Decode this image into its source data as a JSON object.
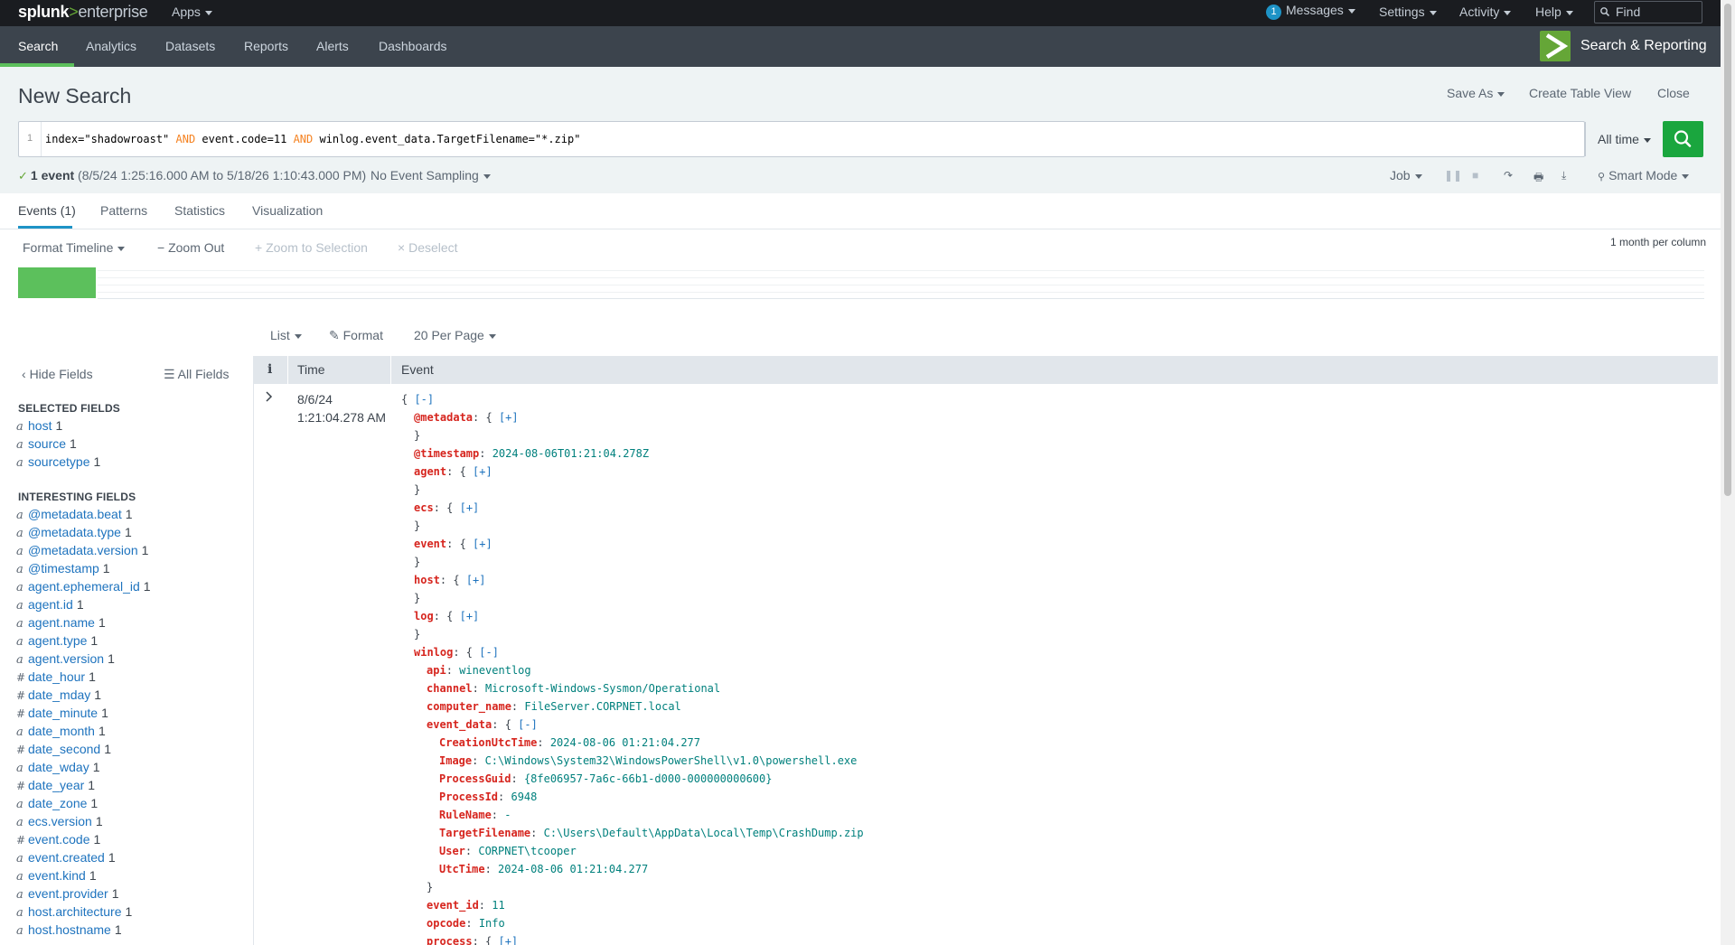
{
  "topbar": {
    "logo_brand": "splunk",
    "logo_sep": ">",
    "logo_product": "enterprise",
    "apps": "Apps",
    "messages_count": "1",
    "messages": "Messages",
    "settings": "Settings",
    "activity": "Activity",
    "help": "Help",
    "find_placeholder": "Find"
  },
  "appnav": {
    "items": [
      "Search",
      "Analytics",
      "Datasets",
      "Reports",
      "Alerts",
      "Dashboards"
    ],
    "active": "Search",
    "app_title": "Search & Reporting",
    "accent": "#65a637"
  },
  "header": {
    "title": "New Search",
    "save_as": "Save As",
    "create_table_view": "Create Table View",
    "close": "Close"
  },
  "search": {
    "line_number": "1",
    "query_parts": [
      {
        "t": "index=\"shadowroast\" ",
        "kw": false
      },
      {
        "t": "AND",
        "kw": true
      },
      {
        "t": " event.code=11 ",
        "kw": false
      },
      {
        "t": "AND",
        "kw": true
      },
      {
        "t": " winlog.event_data.TargetFilename=\"*.zip\"",
        "kw": false
      }
    ],
    "time_range": "All time",
    "button_color": "#1aa63e"
  },
  "job": {
    "count": "1 event",
    "range": "(8/5/24 1:25:16.000 AM to 5/18/26 1:10:43.000 PM)",
    "sampling": "No Event Sampling",
    "job_label": "Job",
    "mode": "Smart Mode"
  },
  "tabs": [
    "Events (1)",
    "Patterns",
    "Statistics",
    "Visualization"
  ],
  "timeline": {
    "format": "Format Timeline",
    "zoom_out": "Zoom Out",
    "zoom_selection": "Zoom to Selection",
    "deselect": "Deselect",
    "per_column": "1 month per column",
    "bar_color": "#5cc05c"
  },
  "results_controls": {
    "list": "List",
    "format": "Format",
    "per_page": "20 Per Page"
  },
  "sidebar": {
    "hide_fields": "Hide Fields",
    "all_fields": "All Fields",
    "selected_title": "SELECTED FIELDS",
    "selected": [
      {
        "type": "a",
        "name": "host",
        "count": "1"
      },
      {
        "type": "a",
        "name": "source",
        "count": "1"
      },
      {
        "type": "a",
        "name": "sourcetype",
        "count": "1"
      }
    ],
    "interesting_title": "INTERESTING FIELDS",
    "interesting": [
      {
        "type": "a",
        "name": "@metadata.beat",
        "count": "1"
      },
      {
        "type": "a",
        "name": "@metadata.type",
        "count": "1"
      },
      {
        "type": "a",
        "name": "@metadata.version",
        "count": "1"
      },
      {
        "type": "a",
        "name": "@timestamp",
        "count": "1"
      },
      {
        "type": "a",
        "name": "agent.ephemeral_id",
        "count": "1"
      },
      {
        "type": "a",
        "name": "agent.id",
        "count": "1"
      },
      {
        "type": "a",
        "name": "agent.name",
        "count": "1"
      },
      {
        "type": "a",
        "name": "agent.type",
        "count": "1"
      },
      {
        "type": "a",
        "name": "agent.version",
        "count": "1"
      },
      {
        "type": "#",
        "name": "date_hour",
        "count": "1"
      },
      {
        "type": "#",
        "name": "date_mday",
        "count": "1"
      },
      {
        "type": "#",
        "name": "date_minute",
        "count": "1"
      },
      {
        "type": "a",
        "name": "date_month",
        "count": "1"
      },
      {
        "type": "#",
        "name": "date_second",
        "count": "1"
      },
      {
        "type": "a",
        "name": "date_wday",
        "count": "1"
      },
      {
        "type": "#",
        "name": "date_year",
        "count": "1"
      },
      {
        "type": "a",
        "name": "date_zone",
        "count": "1"
      },
      {
        "type": "a",
        "name": "ecs.version",
        "count": "1"
      },
      {
        "type": "#",
        "name": "event.code",
        "count": "1"
      },
      {
        "type": "a",
        "name": "event.created",
        "count": "1"
      },
      {
        "type": "a",
        "name": "event.kind",
        "count": "1"
      },
      {
        "type": "a",
        "name": "event.provider",
        "count": "1"
      },
      {
        "type": "a",
        "name": "host.architecture",
        "count": "1"
      },
      {
        "type": "a",
        "name": "host.hostname",
        "count": "1"
      }
    ]
  },
  "results": {
    "col_info": "i",
    "col_time": "Time",
    "col_event": "Event",
    "event_date": "8/6/24",
    "event_time": "1:21:04.278 AM",
    "event_lines": [
      {
        "indent": 0,
        "parts": [
          {
            "c": "jb",
            "t": "{ "
          },
          {
            "c": "jl",
            "t": "[-]"
          }
        ]
      },
      {
        "indent": 1,
        "parts": [
          {
            "c": "jk",
            "t": "@metadata"
          },
          {
            "c": "jb",
            "t": ": { "
          },
          {
            "c": "jl",
            "t": "[+]"
          }
        ]
      },
      {
        "indent": 1,
        "parts": [
          {
            "c": "jb",
            "t": "}"
          }
        ]
      },
      {
        "indent": 1,
        "parts": [
          {
            "c": "jk",
            "t": "@timestamp"
          },
          {
            "c": "jb",
            "t": ": "
          },
          {
            "c": "jv",
            "t": "2024-08-06T01:21:04.278Z"
          }
        ]
      },
      {
        "indent": 1,
        "parts": [
          {
            "c": "jk",
            "t": "agent"
          },
          {
            "c": "jb",
            "t": ": { "
          },
          {
            "c": "jl",
            "t": "[+]"
          }
        ]
      },
      {
        "indent": 1,
        "parts": [
          {
            "c": "jb",
            "t": "}"
          }
        ]
      },
      {
        "indent": 1,
        "parts": [
          {
            "c": "jk",
            "t": "ecs"
          },
          {
            "c": "jb",
            "t": ": { "
          },
          {
            "c": "jl",
            "t": "[+]"
          }
        ]
      },
      {
        "indent": 1,
        "parts": [
          {
            "c": "jb",
            "t": "}"
          }
        ]
      },
      {
        "indent": 1,
        "parts": [
          {
            "c": "jk",
            "t": "event"
          },
          {
            "c": "jb",
            "t": ": { "
          },
          {
            "c": "jl",
            "t": "[+]"
          }
        ]
      },
      {
        "indent": 1,
        "parts": [
          {
            "c": "jb",
            "t": "}"
          }
        ]
      },
      {
        "indent": 1,
        "parts": [
          {
            "c": "jk",
            "t": "host"
          },
          {
            "c": "jb",
            "t": ": { "
          },
          {
            "c": "jl",
            "t": "[+]"
          }
        ]
      },
      {
        "indent": 1,
        "parts": [
          {
            "c": "jb",
            "t": "}"
          }
        ]
      },
      {
        "indent": 1,
        "parts": [
          {
            "c": "jk",
            "t": "log"
          },
          {
            "c": "jb",
            "t": ": { "
          },
          {
            "c": "jl",
            "t": "[+]"
          }
        ]
      },
      {
        "indent": 1,
        "parts": [
          {
            "c": "jb",
            "t": "}"
          }
        ]
      },
      {
        "indent": 1,
        "parts": [
          {
            "c": "jk",
            "t": "winlog"
          },
          {
            "c": "jb",
            "t": ": { "
          },
          {
            "c": "jl",
            "t": "[-]"
          }
        ]
      },
      {
        "indent": 2,
        "parts": [
          {
            "c": "jk",
            "t": "api"
          },
          {
            "c": "jb",
            "t": ": "
          },
          {
            "c": "jv",
            "t": "wineventlog"
          }
        ]
      },
      {
        "indent": 2,
        "parts": [
          {
            "c": "jk",
            "t": "channel"
          },
          {
            "c": "jb",
            "t": ": "
          },
          {
            "c": "jv",
            "t": "Microsoft-Windows-Sysmon/Operational"
          }
        ]
      },
      {
        "indent": 2,
        "parts": [
          {
            "c": "jk",
            "t": "computer_name"
          },
          {
            "c": "jb",
            "t": ": "
          },
          {
            "c": "jv",
            "t": "FileServer.CORPNET.local"
          }
        ]
      },
      {
        "indent": 2,
        "parts": [
          {
            "c": "jk",
            "t": "event_data"
          },
          {
            "c": "jb",
            "t": ": { "
          },
          {
            "c": "jl",
            "t": "[-]"
          }
        ]
      },
      {
        "indent": 3,
        "parts": [
          {
            "c": "jk",
            "t": "CreationUtcTime"
          },
          {
            "c": "jb",
            "t": ": "
          },
          {
            "c": "jv",
            "t": "2024-08-06 01:21:04.277"
          }
        ]
      },
      {
        "indent": 3,
        "parts": [
          {
            "c": "jk",
            "t": "Image"
          },
          {
            "c": "jb",
            "t": ": "
          },
          {
            "c": "jv",
            "t": "C:\\Windows\\System32\\WindowsPowerShell\\v1.0\\powershell.exe"
          }
        ]
      },
      {
        "indent": 3,
        "parts": [
          {
            "c": "jk",
            "t": "ProcessGuid"
          },
          {
            "c": "jb",
            "t": ": "
          },
          {
            "c": "jv",
            "t": "{8fe06957-7a6c-66b1-d000-000000000600}"
          }
        ]
      },
      {
        "indent": 3,
        "parts": [
          {
            "c": "jk",
            "t": "ProcessId"
          },
          {
            "c": "jb",
            "t": ": "
          },
          {
            "c": "jv",
            "t": "6948"
          }
        ]
      },
      {
        "indent": 3,
        "parts": [
          {
            "c": "jk",
            "t": "RuleName"
          },
          {
            "c": "jb",
            "t": ": "
          },
          {
            "c": "jv",
            "t": "-"
          }
        ]
      },
      {
        "indent": 3,
        "parts": [
          {
            "c": "jk",
            "t": "TargetFilename"
          },
          {
            "c": "jb",
            "t": ": "
          },
          {
            "c": "jv",
            "t": "C:\\Users\\Default\\AppData\\Local\\Temp\\CrashDump.zip"
          }
        ]
      },
      {
        "indent": 3,
        "parts": [
          {
            "c": "jk",
            "t": "User"
          },
          {
            "c": "jb",
            "t": ": "
          },
          {
            "c": "jv",
            "t": "CORPNET\\tcooper"
          }
        ]
      },
      {
        "indent": 3,
        "parts": [
          {
            "c": "jk",
            "t": "UtcTime"
          },
          {
            "c": "jb",
            "t": ": "
          },
          {
            "c": "jv",
            "t": "2024-08-06 01:21:04.277"
          }
        ]
      },
      {
        "indent": 2,
        "parts": [
          {
            "c": "jb",
            "t": "}"
          }
        ]
      },
      {
        "indent": 2,
        "parts": [
          {
            "c": "jk",
            "t": "event_id"
          },
          {
            "c": "jb",
            "t": ": "
          },
          {
            "c": "jv",
            "t": "11"
          }
        ]
      },
      {
        "indent": 2,
        "parts": [
          {
            "c": "jk",
            "t": "opcode"
          },
          {
            "c": "jb",
            "t": ": "
          },
          {
            "c": "jv",
            "t": "Info"
          }
        ]
      },
      {
        "indent": 2,
        "parts": [
          {
            "c": "jk",
            "t": "process"
          },
          {
            "c": "jb",
            "t": ": { "
          },
          {
            "c": "jl",
            "t": "[+]"
          }
        ]
      }
    ]
  }
}
